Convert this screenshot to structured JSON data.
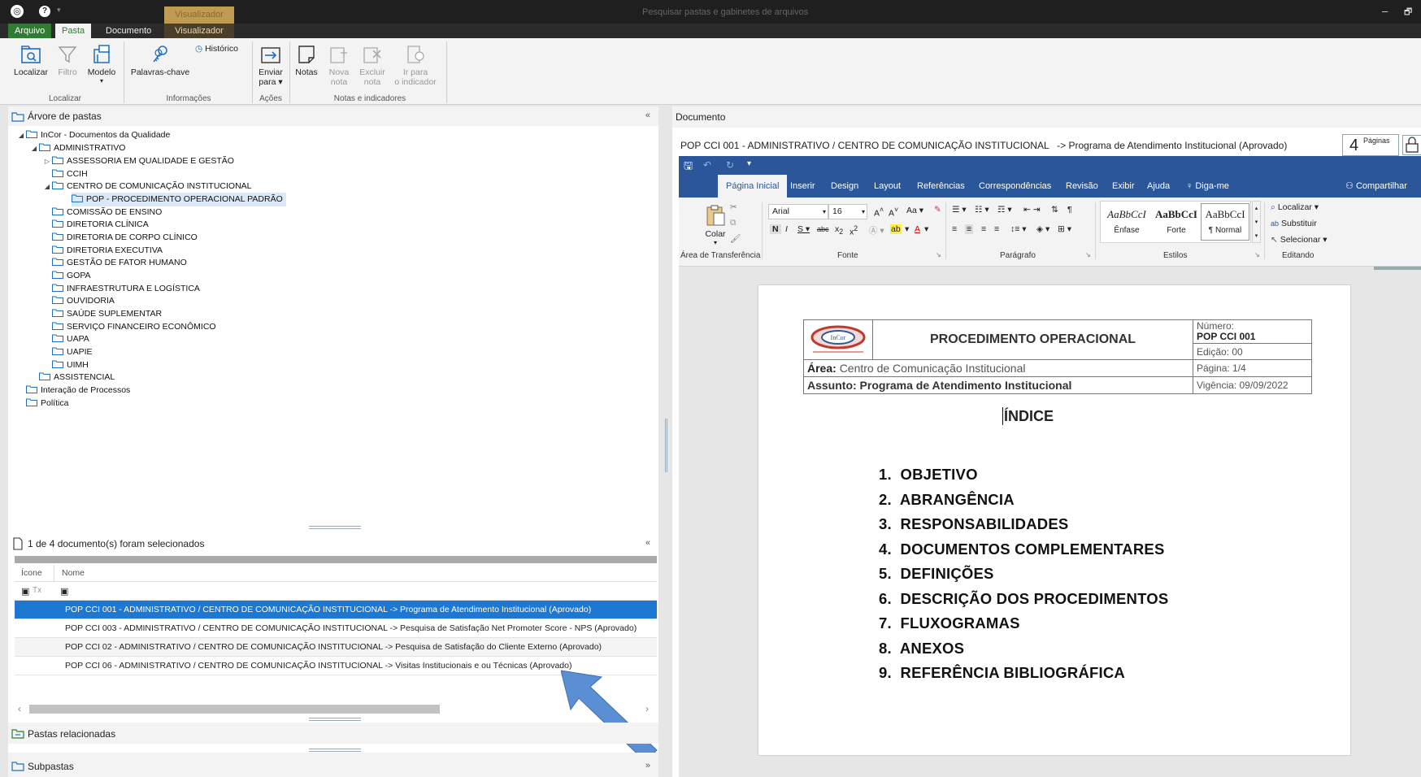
{
  "titlebar": {
    "search_placeholder": "Pesquisar pastas e gabinetes de arquivos",
    "context_label": "Visualizador",
    "minimize": "–",
    "restore": "🗗"
  },
  "tabs": {
    "file": "Arquivo",
    "pasta": "Pasta",
    "documento": "Documento",
    "visualizador": "Visualizador"
  },
  "ribbon": {
    "localizar": "Localizar",
    "filtro": "Filtro",
    "modelo": "Modelo",
    "palavras_chave": "Palavras-chave",
    "historico": "Histórico",
    "enviar_para_1": "Enviar",
    "enviar_para_2": "para ▾",
    "notas": "Notas",
    "nova_nota_1": "Nova",
    "nova_nota_2": "nota",
    "excluir_nota_1": "Excluir",
    "excluir_nota_2": "nota",
    "ir_indicador_1": "Ir para",
    "ir_indicador_2": "o indicador",
    "group_localizar": "Localizar",
    "group_informacoes": "Informações",
    "group_acoes": "Ações",
    "group_notas": "Notas e indicadores"
  },
  "tree": {
    "header": "Árvore de pastas",
    "nodes": [
      {
        "label": "InCor - Documentos da Qualidade"
      },
      {
        "label": "ADMINISTRATIVO"
      },
      {
        "label": "ASSESSORIA EM QUALIDADE E GESTÃO"
      },
      {
        "label": "CCIH"
      },
      {
        "label": "CENTRO DE COMUNICAÇÃO INSTITUCIONAL"
      },
      {
        "label": "POP - PROCEDIMENTO OPERACIONAL PADRÃO"
      },
      {
        "label": "COMISSÃO DE ENSINO"
      },
      {
        "label": "DIRETORIA CLÍNICA"
      },
      {
        "label": "DIRETORIA DE CORPO CLÍNICO"
      },
      {
        "label": "DIRETORIA EXECUTIVA"
      },
      {
        "label": "GESTÃO DE FATOR HUMANO"
      },
      {
        "label": "GOPA"
      },
      {
        "label": "INFRAESTRUTURA E LOGÍSTICA"
      },
      {
        "label": "OUVIDORIA"
      },
      {
        "label": "SAÚDE SUPLEMENTAR"
      },
      {
        "label": "SERVIÇO FINANCEIRO ECONÔMICO"
      },
      {
        "label": "UAPA"
      },
      {
        "label": "UAPIE"
      },
      {
        "label": "UIMH"
      },
      {
        "label": "ASSISTENCIAL"
      },
      {
        "label": "Interação de Processos"
      },
      {
        "label": "Política"
      }
    ]
  },
  "doclist": {
    "header": "1 de 4 documento(s) foram selecionados",
    "col_icon": "Ícone",
    "col_name": "Nome",
    "rows": [
      {
        "name": "POP CCI 001 - ADMINISTRATIVO / CENTRO DE COMUNICAÇÃO INSTITUCIONAL   -> Programa de Atendimento Institucional (Aprovado)"
      },
      {
        "name": "POP CCI 003 - ADMINISTRATIVO / CENTRO DE COMUNICAÇÃO INSTITUCIONAL   -> Pesquisa de Satisfação Net Promoter Score - NPS (Aprovado)"
      },
      {
        "name": "POP CCI 02 - ADMINISTRATIVO / CENTRO DE COMUNICAÇÃO INSTITUCIONAL   -> Pesquisa de Satisfação do Cliente Externo (Aprovado)"
      },
      {
        "name": "POP CCI 06 - ADMINISTRATIVO / CENTRO DE COMUNICAÇÃO INSTITUCIONAL   -> Visitas Institucionais e ou Técnicas (Aprovado)"
      }
    ]
  },
  "related": {
    "label": "Pastas relacionadas"
  },
  "subfolders": {
    "label": "Subpastas"
  },
  "document": {
    "header": "Documento",
    "title": "POP CCI 001 - ADMINISTRATIVO / CENTRO DE COMUNICAÇÃO INSTITUCIONAL   -> Programa de Atendimento Institucional (Aprovado)",
    "pages_count": "4",
    "pages_label": "Páginas"
  },
  "word": {
    "tabs": [
      "Página Inicial",
      "Inserir",
      "Design",
      "Layout",
      "Referências",
      "Correspondências",
      "Revisão",
      "Exibir",
      "Ajuda",
      "Diga-me"
    ],
    "share": "Compartilhar",
    "font_name": "Arial",
    "font_size": "16",
    "colar": "Colar",
    "styles": [
      "AaBbCcI",
      "AaBbCcI",
      "AaBbCcI"
    ],
    "style_names": [
      "Ênfase",
      "Forte",
      "¶ Normal"
    ],
    "localizar": "Localizar",
    "substituir": "Substituir",
    "selecionar": "Selecionar",
    "groups": [
      "Área de Transferência",
      "Fonte",
      "Parágrafo",
      "Estilos",
      "Editando"
    ]
  },
  "page": {
    "logo_text": "InCor",
    "title": "PROCEDIMENTO OPERACIONAL",
    "numero_label": "Número:",
    "numero": "POP CCI 001",
    "edicao": "Edição: 00",
    "area_label": "Área:",
    "area": "Centro de Comunicação Institucional",
    "pagina": "Página: 1/4",
    "assunto": "Assunto: Programa de Atendimento Institucional",
    "vigencia": "Vigência: 09/09/2022",
    "indice": "ÍNDICE",
    "items": [
      "1.  OBJETIVO",
      "2.  ABRANGÊNCIA",
      "3.  RESPONSABILIDADES",
      "4.  DOCUMENTOS COMPLEMENTARES",
      "5.  DEFINIÇÕES",
      "6.  DESCRIÇÃO DOS PROCEDIMENTOS",
      "7.  FLUXOGRAMAS",
      "8.  ANEXOS",
      "9.  REFERÊNCIA BIBLIOGRÁFICA"
    ]
  },
  "colors": {
    "file_tab": "#2e7d32",
    "selection": "#1e78d2",
    "word_blue": "#2b579a",
    "arrow": "#5b8fd4"
  }
}
